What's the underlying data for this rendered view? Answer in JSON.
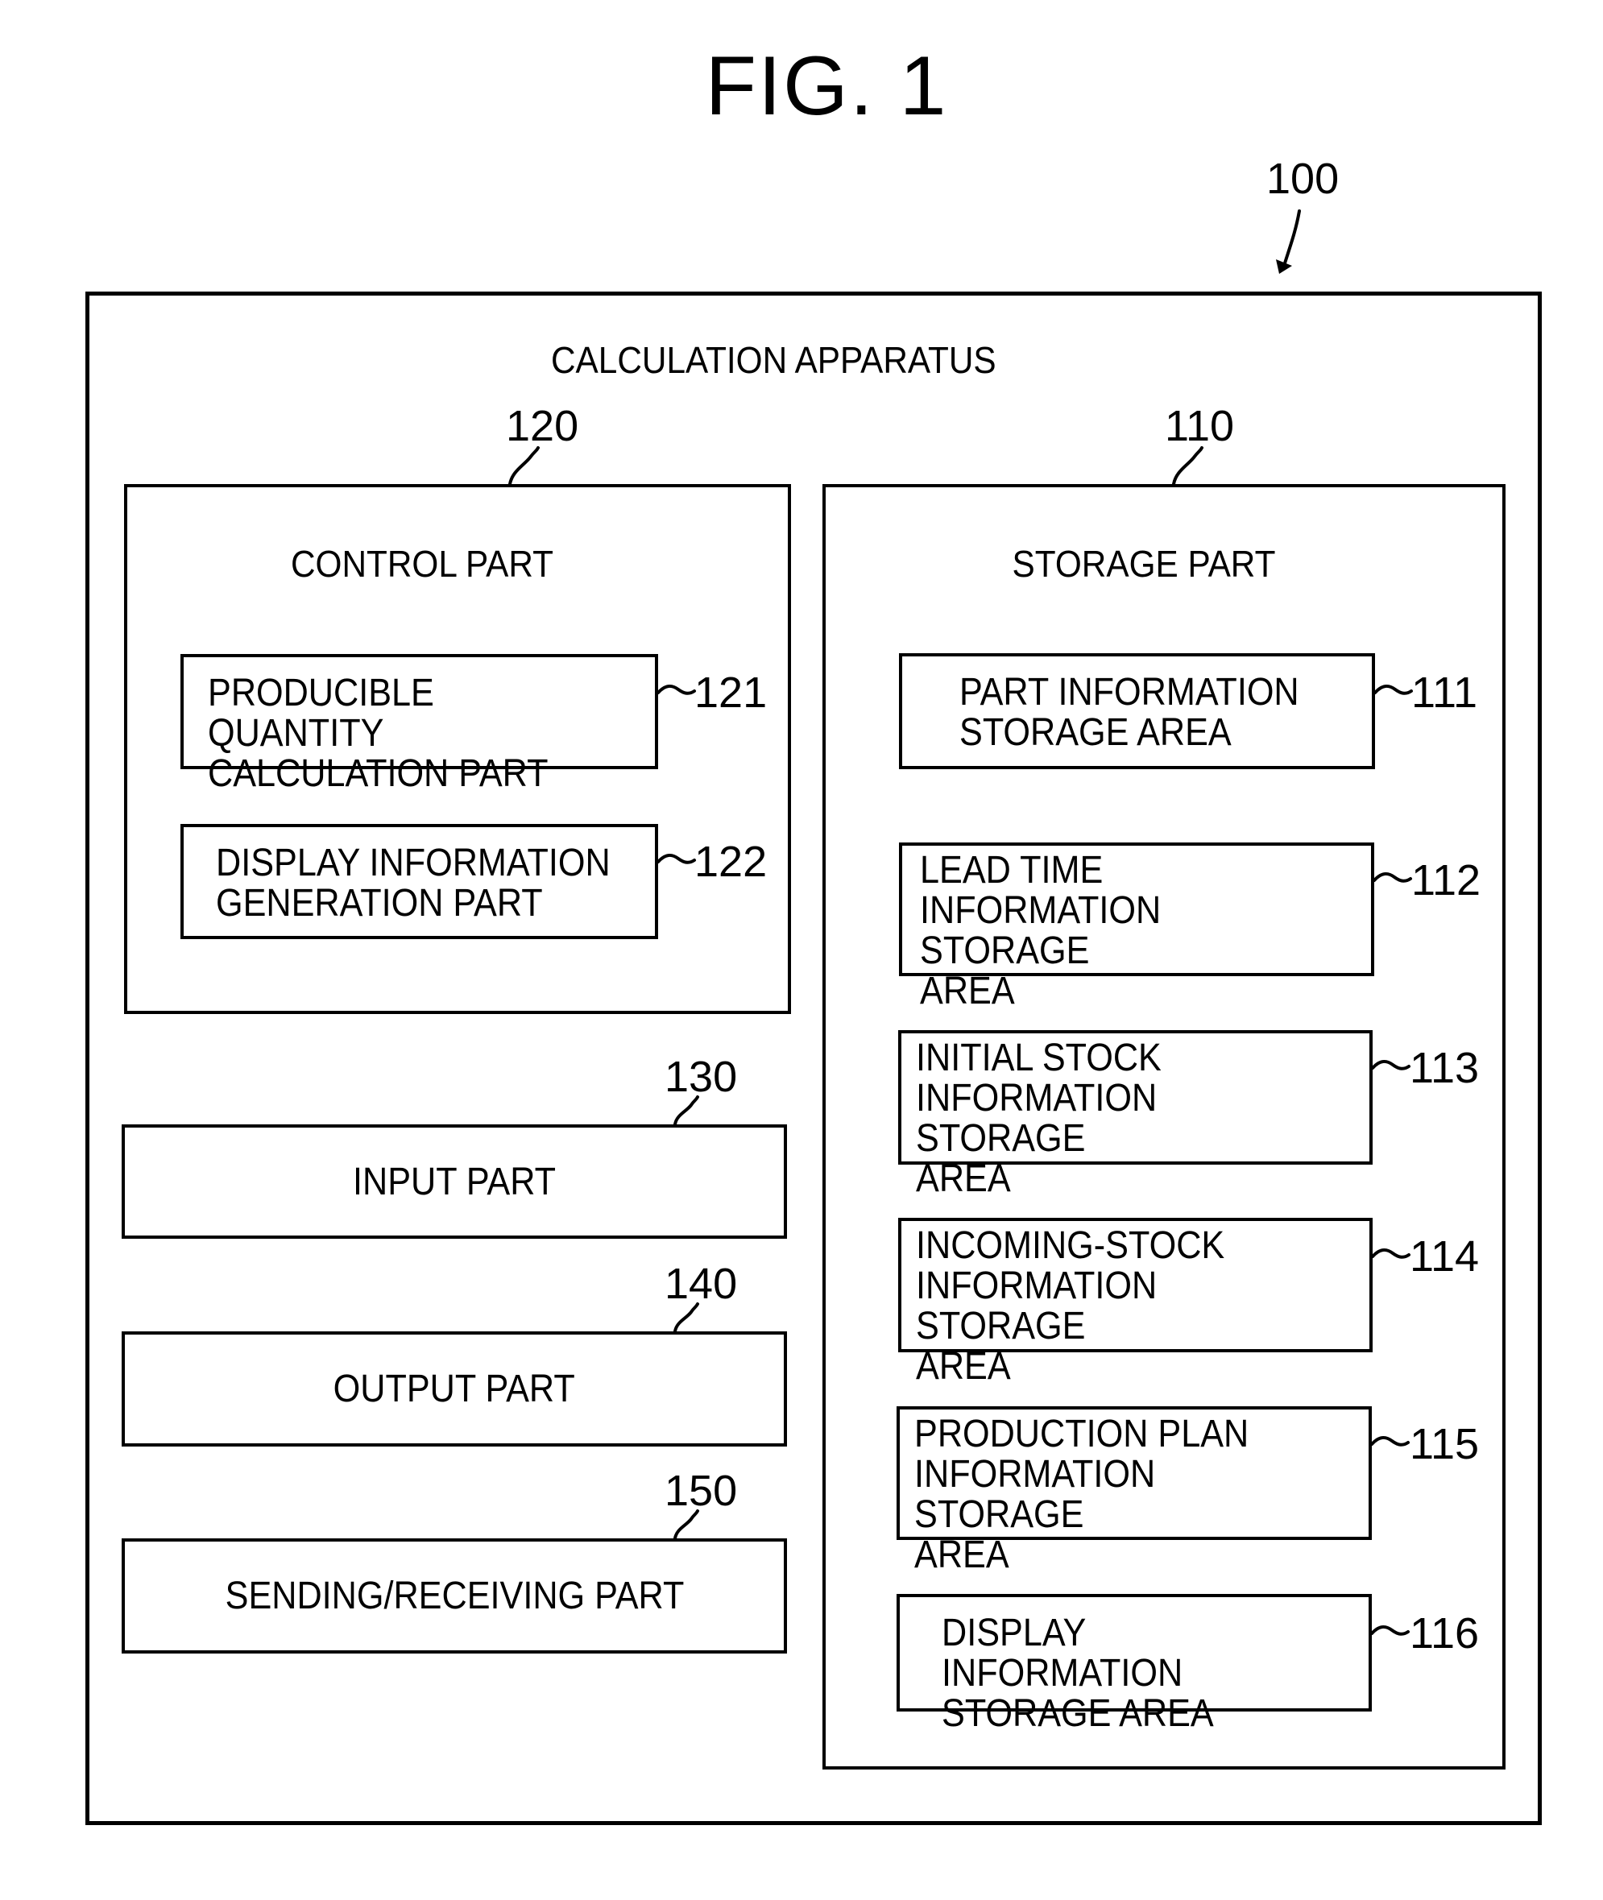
{
  "figure": {
    "title": "FIG. 1",
    "apparatus": {
      "ref": "100",
      "label": "CALCULATION APPARATUS"
    },
    "control_part": {
      "ref": "120",
      "label": "CONTROL PART",
      "children": [
        {
          "ref": "121",
          "label": "PRODUCIBLE QUANTITY\nCALCULATION PART"
        },
        {
          "ref": "122",
          "label": "DISPLAY INFORMATION\nGENERATION PART"
        }
      ]
    },
    "io_parts": [
      {
        "ref": "130",
        "label": "INPUT PART"
      },
      {
        "ref": "140",
        "label": "OUTPUT PART"
      },
      {
        "ref": "150",
        "label": "SENDING/RECEIVING PART"
      }
    ],
    "storage_part": {
      "ref": "110",
      "label": "STORAGE PART",
      "children": [
        {
          "ref": "111",
          "label": "PART INFORMATION\nSTORAGE AREA"
        },
        {
          "ref": "112",
          "label": "LEAD TIME\nINFORMATION STORAGE\nAREA"
        },
        {
          "ref": "113",
          "label": "INITIAL STOCK\nINFORMATION STORAGE\nAREA"
        },
        {
          "ref": "114",
          "label": "INCOMING-STOCK\nINFORMATION STORAGE\nAREA"
        },
        {
          "ref": "115",
          "label": "PRODUCTION PLAN\nINFORMATION STORAGE\nAREA"
        },
        {
          "ref": "116",
          "label": "DISPLAY INFORMATION\nSTORAGE AREA"
        }
      ]
    }
  }
}
